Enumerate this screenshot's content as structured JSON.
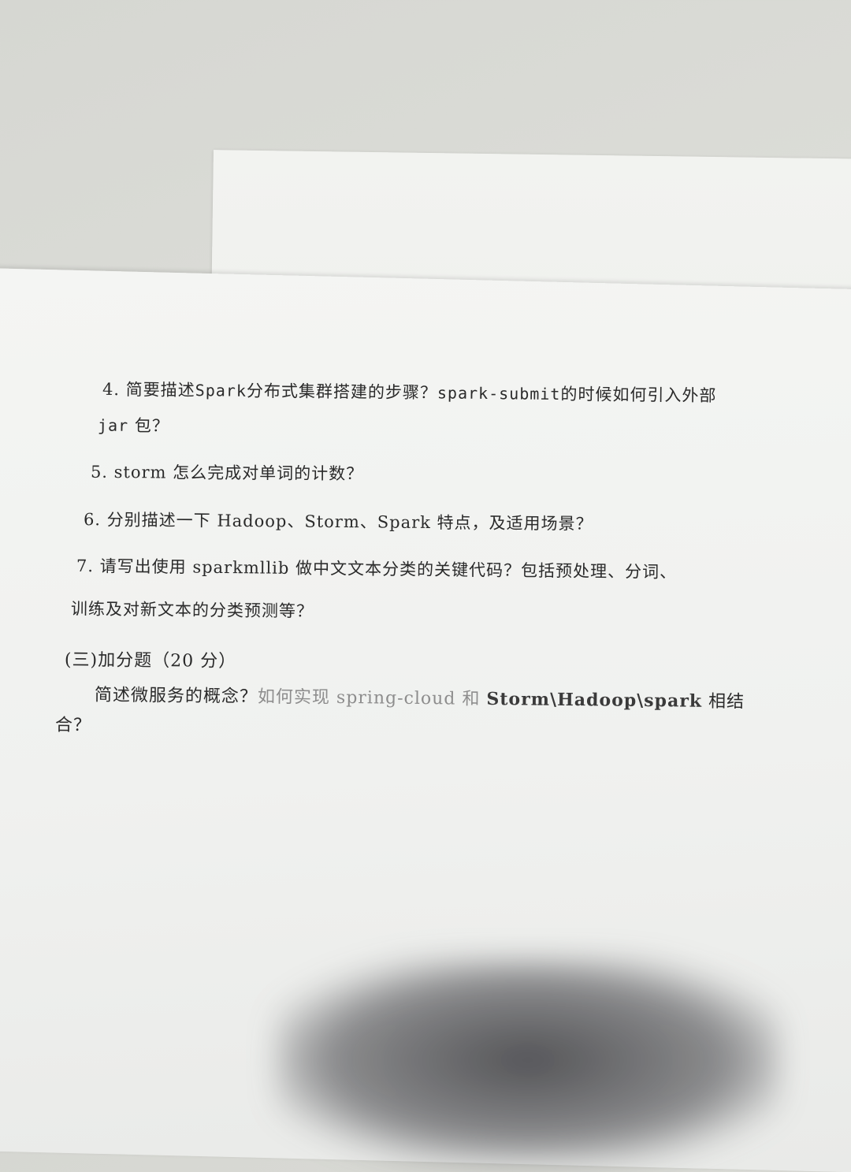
{
  "questions": {
    "q4_line1_num": "4.",
    "q4_line1_a": "简要描述",
    "q4_line1_b": "Spark",
    "q4_line1_c": "分布式集群搭建的步骤？",
    "q4_line1_d": "spark-submit",
    "q4_line1_e": "的时候如何引入外部",
    "q4_line2_a": "jar",
    "q4_line2_b": "包？",
    "q5": "5.  storm 怎么完成对单词的计数？",
    "q6": "6.  分别描述一下 Hadoop、Storm、Spark 特点，及适用场景？",
    "q7_line1": "7.  请写出使用 sparkmllib 做中文文本分类的关键代码？包括预处理、分词、",
    "q7_line2": "训练及对新文本的分类预测等？"
  },
  "bonus_section": {
    "heading": "(三)加分题（20 分）",
    "line1_a": "简述微服务的概念？",
    "line1_b": "如何实现 spring-cloud  和",
    "line1_c": "Storm\\Hadoop\\spark",
    "line1_d": "相结",
    "line2": "合？"
  }
}
